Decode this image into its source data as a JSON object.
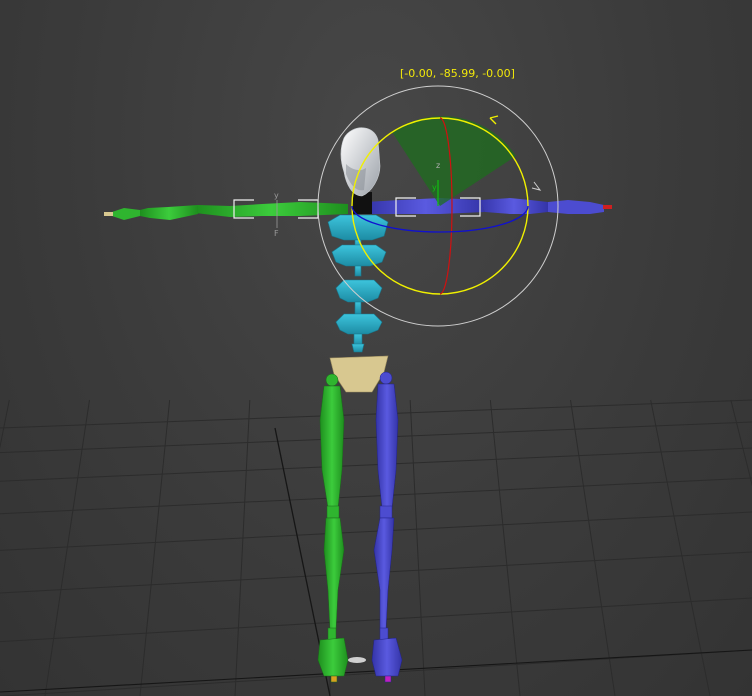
{
  "viewport": {
    "background_color": "#3c3c3c",
    "grid_color": "#2a2a2a"
  },
  "gizmo": {
    "type": "rotate-gizmo",
    "readout": "[-0.00, -85.99, -0.00]",
    "readout_color": "#f2e80a",
    "axis_label_z": "z",
    "axis_label_y": "y",
    "arm_label_y": "y",
    "arm_label_f": "F",
    "colors": {
      "x_axis": "#d01010",
      "y_axis": "#10c010",
      "z_axis": "#1010d0",
      "screen_ring": "#cfcfcf",
      "active_ring": "#f0f000",
      "sweep": "#1e6e1e"
    }
  },
  "skeleton": {
    "left_color": "#2db52d",
    "right_color": "#4848c8",
    "spine_color": "#2aa6c0",
    "pelvis_color": "#d8c890",
    "head_color": "#e8ecf0"
  }
}
